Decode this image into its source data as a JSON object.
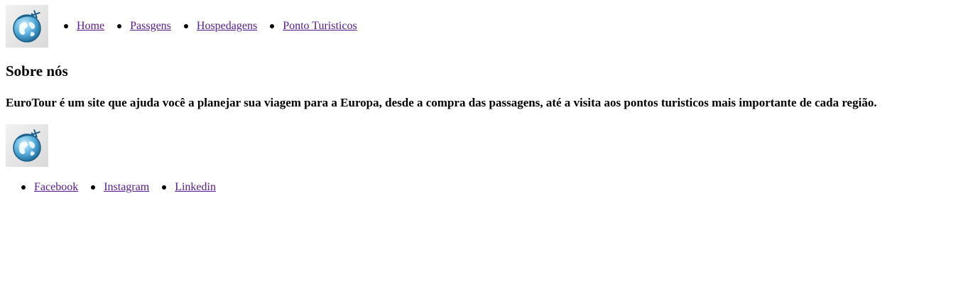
{
  "header": {
    "logo_icon": "globe-plane-icon",
    "nav": [
      {
        "label": "Home"
      },
      {
        "label": "Passgens"
      },
      {
        "label": "Hospedagens"
      },
      {
        "label": "Ponto Turisticos"
      }
    ]
  },
  "main": {
    "title": "Sobre nós",
    "about_text": "EuroTour é um site que ajuda você a planejar sua viagem para a Europa, desde a compra das passagens, até a visita aos pontos turisticos mais importante de cada região."
  },
  "footer": {
    "logo_icon": "globe-plane-icon",
    "social": [
      {
        "label": "Facebook"
      },
      {
        "label": "Instagram"
      },
      {
        "label": "Linkedin"
      }
    ]
  },
  "colors": {
    "link_visited": "#551a8b",
    "globe_blue": "#2a7fb8",
    "globe_light": "#8fd0ef"
  }
}
